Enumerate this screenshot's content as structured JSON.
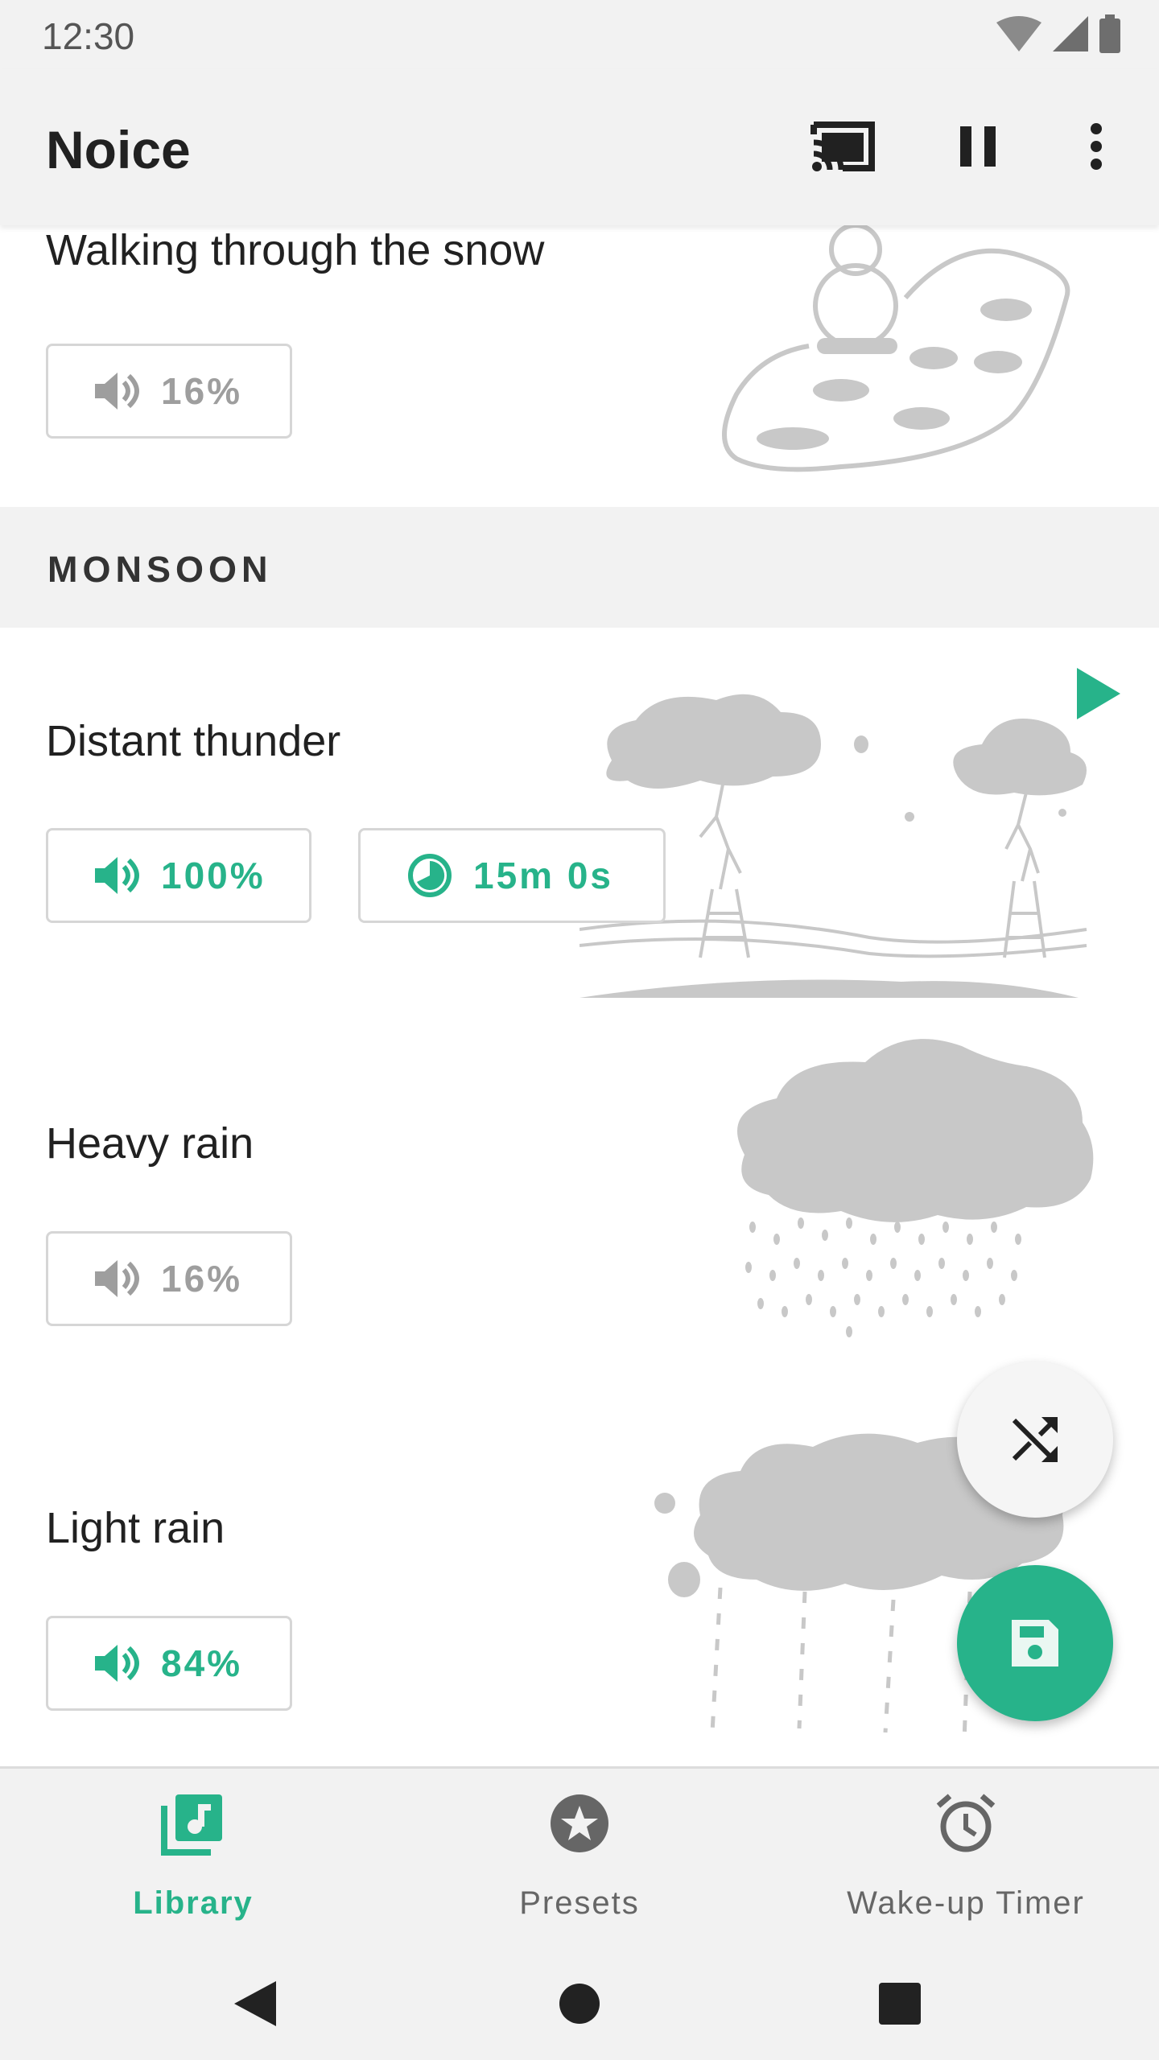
{
  "status_bar": {
    "time": "12:30"
  },
  "app_bar": {
    "title": "Noice",
    "actions": [
      "cast-icon",
      "pause-icon",
      "more-vert-icon"
    ]
  },
  "cards": {
    "snow": {
      "name": "Walking through the snow",
      "volume": "16%",
      "active": false
    },
    "section_monsoon": "MONSOON",
    "thunder": {
      "name": "Distant thunder",
      "volume": "100%",
      "timer": "15m 0s",
      "active": true
    },
    "heavy_rain": {
      "name": "Heavy rain",
      "volume": "16%",
      "active": false
    },
    "light_rain": {
      "name": "Light rain",
      "volume": "84%",
      "active": true
    }
  },
  "fabs": {
    "shuffle": "shuffle-icon",
    "save": "save-icon"
  },
  "bottom_nav": {
    "items": [
      {
        "label": "Library",
        "icon": "library-music-icon",
        "selected": true
      },
      {
        "label": "Presets",
        "icon": "star-icon",
        "selected": false
      },
      {
        "label": "Wake-up Timer",
        "icon": "alarm-icon",
        "selected": false
      }
    ]
  },
  "colors": {
    "accent": "#27b38a",
    "inactive": "#9e9e9e",
    "art": "#c8c8c8",
    "bar": "#f2f2f2"
  }
}
